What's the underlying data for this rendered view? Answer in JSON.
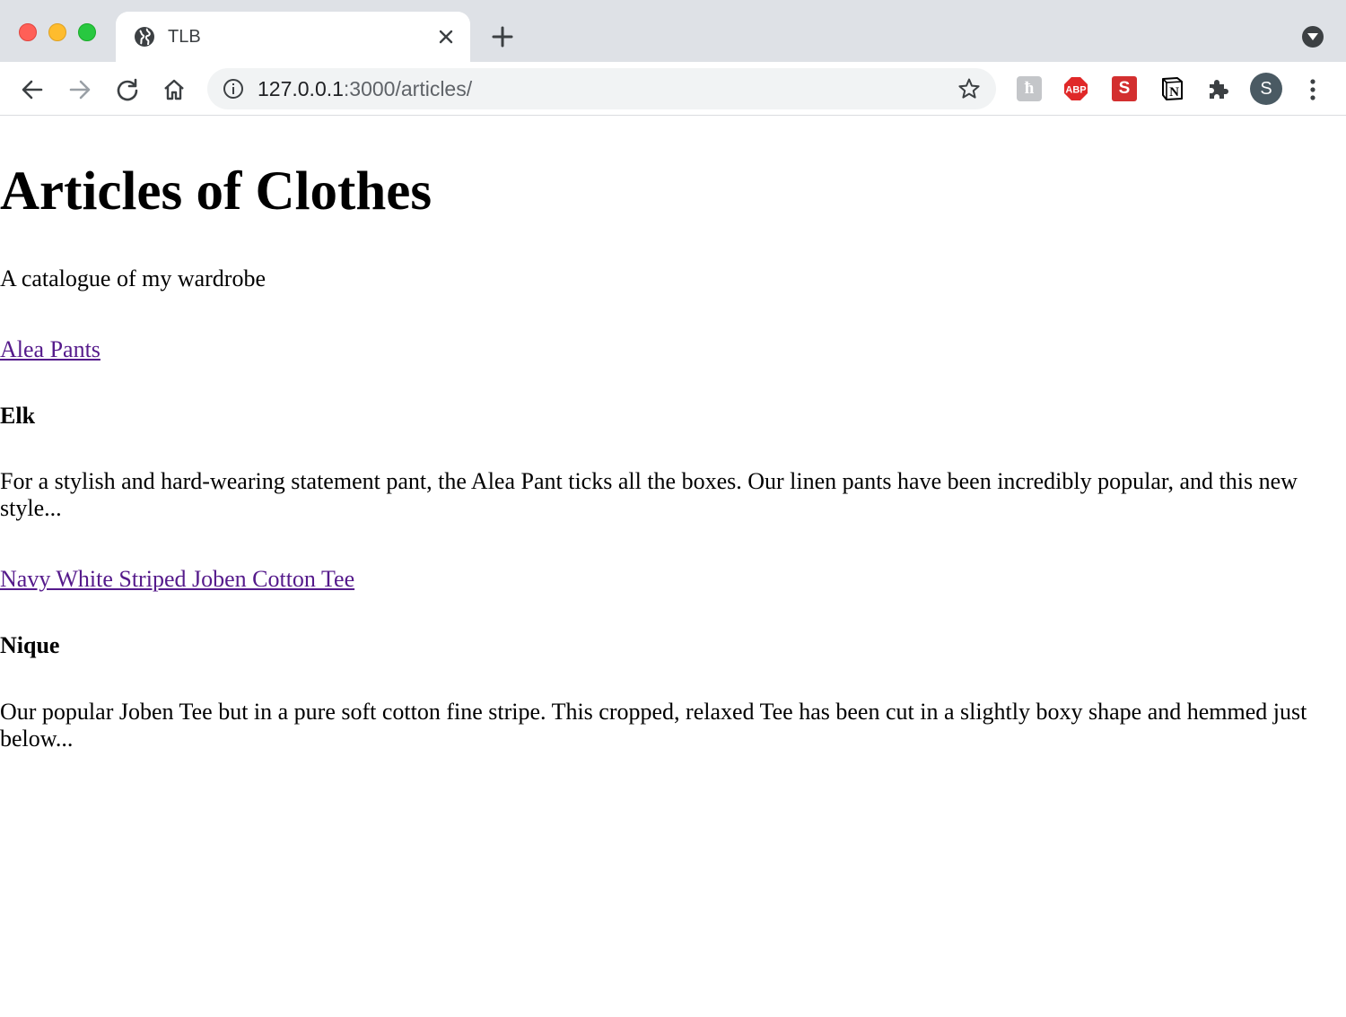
{
  "browser": {
    "tab": {
      "title": "TLB"
    },
    "address": {
      "host": "127.0.0.1",
      "rest": ":3000/articles/"
    },
    "profile_initial": "S",
    "extensions": {
      "h_label": "ћ",
      "abp_label": "ABP",
      "s_label": "S",
      "n_label": "N"
    }
  },
  "page": {
    "title": "Articles of Clothes",
    "tagline": "A catalogue of my wardrobe",
    "articles": [
      {
        "name": "Alea Pants",
        "brand": "Elk",
        "description": "For a stylish and hard-wearing statement pant, the Alea Pant ticks all the boxes. Our linen pants have been incredibly popular, and this new style..."
      },
      {
        "name": "Navy White Striped Joben Cotton Tee",
        "brand": "Nique",
        "description": "Our popular Joben Tee but in a pure soft cotton fine stripe. This cropped, relaxed Tee has been cut in a slightly boxy shape and hemmed just below..."
      }
    ]
  },
  "colors": {
    "link_visited": "#551a8b",
    "tabstrip_bg": "#dee1e6",
    "omnibox_bg": "#f1f3f4"
  }
}
